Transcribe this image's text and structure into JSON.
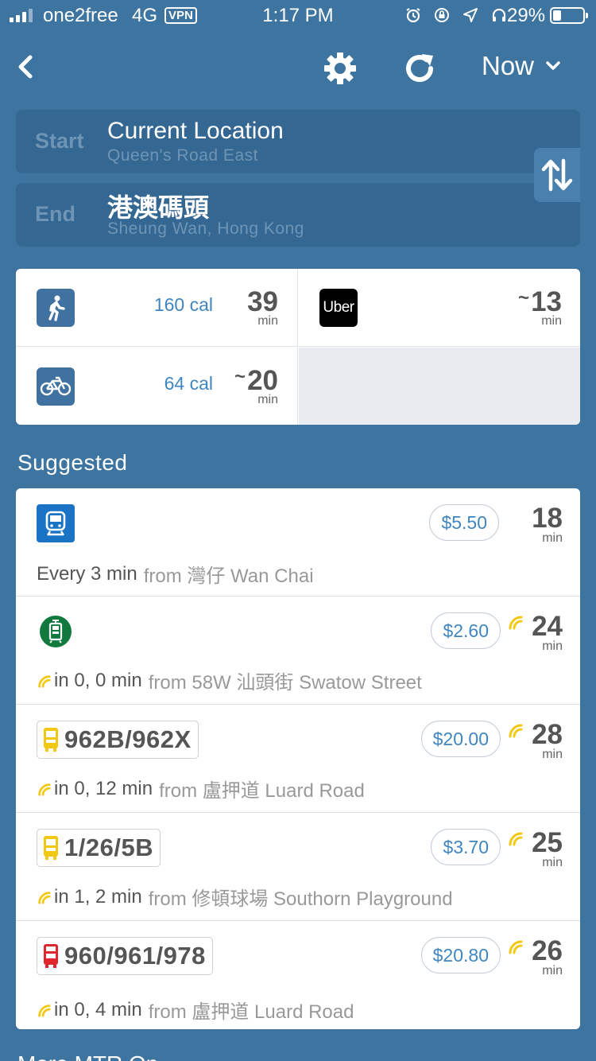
{
  "status_bar": {
    "carrier": "one2free",
    "network": "4G",
    "vpn": "VPN",
    "time": "1:17 PM",
    "battery": "29%",
    "icons": [
      "alarm-icon",
      "rotation-lock-icon",
      "location-arrow-icon",
      "headphones-icon"
    ]
  },
  "nav": {
    "time_selector": "Now"
  },
  "start": {
    "tag": "Start",
    "title": "Current Location",
    "subtitle": "Queen's Road East"
  },
  "end": {
    "tag": "End",
    "title": "港澳碼頭",
    "subtitle": "Sheung Wan, Hong Kong"
  },
  "modes": {
    "walk": {
      "cal": "160 cal",
      "value": "39",
      "unit": "min"
    },
    "uber": {
      "label": "Uber",
      "approx": "~",
      "value": "13",
      "unit": "min"
    },
    "bike": {
      "cal": "64 cal",
      "approx": "~",
      "value": "20",
      "unit": "min"
    }
  },
  "suggested": {
    "title": "Suggested",
    "routes": [
      {
        "type": "mtr",
        "fare": "$5.50",
        "duration": "18",
        "unit": "min",
        "info": "Every 3 min",
        "from": "from 灣仔 Wan Chai",
        "realtime": false
      },
      {
        "type": "tram",
        "fare": "$2.60",
        "duration": "24",
        "unit": "min",
        "info": "in 0, 0 min",
        "from": "from 58W 汕頭街 Swatow Street",
        "realtime": true
      },
      {
        "type": "bus",
        "badge": "962B/962X",
        "fare": "$20.00",
        "duration": "28",
        "unit": "min",
        "info": "in 0, 12 min",
        "from": "from 盧押道 Luard Road",
        "realtime": true
      },
      {
        "type": "bus",
        "badge": "1/26/5B",
        "fare": "$3.70",
        "duration": "25",
        "unit": "min",
        "info": "in 1, 2 min",
        "from": "from 修頓球場 Southorn Playground",
        "realtime": true
      },
      {
        "type": "bus-red",
        "badge": "960/961/978",
        "fare": "$20.80",
        "duration": "26",
        "unit": "min",
        "info": "in 0, 4 min",
        "from": "from 盧押道 Luard Road",
        "realtime": true
      }
    ]
  },
  "bottom_peek": "More MTR Op..."
}
